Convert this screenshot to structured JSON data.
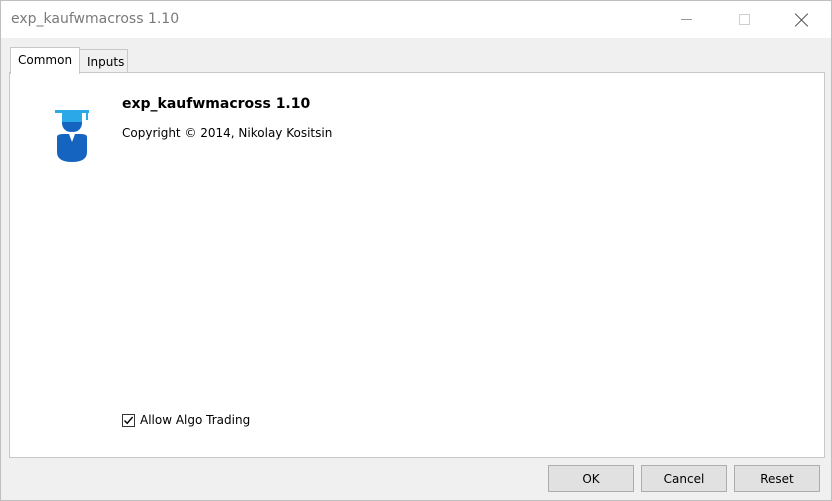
{
  "window": {
    "title": "exp_kaufwmacross 1.10",
    "controls": [
      "minimize-icon",
      "maximize-icon",
      "close-icon"
    ]
  },
  "tabs": [
    {
      "label": "Common",
      "selected": true
    },
    {
      "label": "Inputs",
      "selected": false
    }
  ],
  "common": {
    "icon": "graduate-user-icon",
    "name": "exp_kaufwmacross 1.10",
    "copyright": "Copyright © 2014, Nikolay Kositsin",
    "allow_algo_trading": {
      "label": "Allow Algo Trading",
      "checked": true
    }
  },
  "buttons": {
    "ok": "OK",
    "cancel": "Cancel",
    "reset": "Reset"
  },
  "colors": {
    "icon_light_blue": "#2aa8e8",
    "icon_dark_blue": "#1565c0"
  }
}
